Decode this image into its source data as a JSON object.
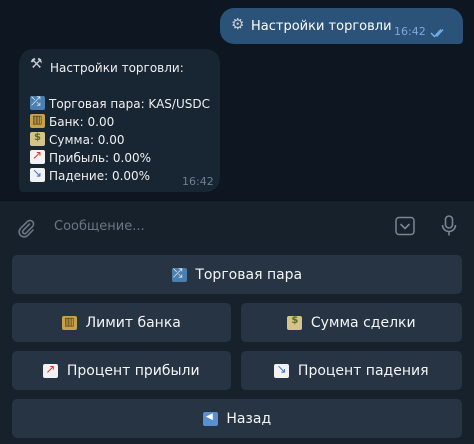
{
  "messages": {
    "outgoing": {
      "icon": "gear-icon",
      "text": "Настройки торговли",
      "time": "16:42",
      "status": "read"
    },
    "incoming": {
      "title_icon": "tools-icon",
      "title": "Настройки торговли:",
      "lines": [
        {
          "icon": "shuffle-icon",
          "text": "Торговая пара: KAS/USDC"
        },
        {
          "icon": "bank-icon",
          "text": "Банк: 0.00"
        },
        {
          "icon": "money-icon",
          "text": "Сумма: 0.00"
        },
        {
          "icon": "chart-up-icon",
          "text": "Прибыль: 0.00%"
        },
        {
          "icon": "chart-down-icon",
          "text": "Падение: 0.00%"
        }
      ],
      "time": "16:42"
    }
  },
  "composer": {
    "placeholder": "Сообщение..."
  },
  "keyboard": {
    "buttons": [
      {
        "icon": "shuffle-icon",
        "label": "Торговая пара"
      },
      {
        "icon": "bank-icon",
        "label": "Лимит банка"
      },
      {
        "icon": "money-icon",
        "label": "Сумма сделки"
      },
      {
        "icon": "chart-up-icon",
        "label": "Процент прибыли"
      },
      {
        "icon": "chart-down-icon",
        "label": "Процент падения"
      },
      {
        "icon": "back-arrow-icon",
        "label": "Назад"
      }
    ]
  },
  "colors": {
    "background": "#0e1621",
    "outgoing_bubble": "#2b5278",
    "incoming_bubble": "#182533",
    "panel": "#17212b",
    "button": "#273444",
    "read_check": "#6fb2f0"
  }
}
